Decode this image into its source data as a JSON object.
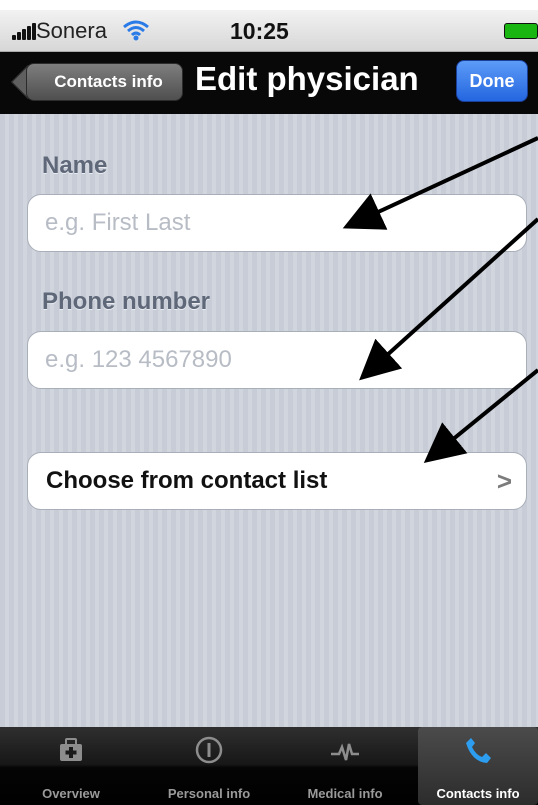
{
  "status_bar": {
    "carrier": "Sonera",
    "time": "10:25",
    "icons": {
      "signal": "signal-bars-icon",
      "wifi": "wifi-icon",
      "battery": "battery-icon"
    }
  },
  "nav_bar": {
    "back_label": "Contacts info",
    "title": "Edit physician",
    "done_label": "Done"
  },
  "form": {
    "name_label": "Name",
    "name_placeholder": "e.g. First Last",
    "phone_label": "Phone number",
    "phone_placeholder": "e.g. 123 4567890",
    "contact_button_label": "Choose from contact list",
    "disclosure": ">"
  },
  "tabs": [
    {
      "label": "Overview",
      "icon": "medical-kit-icon",
      "selected": false
    },
    {
      "label": "Personal info",
      "icon": "info-icon",
      "selected": false
    },
    {
      "label": "Medical info",
      "icon": "heartbeat-icon",
      "selected": false
    },
    {
      "label": "Contacts info",
      "icon": "phone-icon",
      "selected": true
    }
  ],
  "colors": {
    "nav_background": "#080808",
    "done_blue": "#2466e0",
    "content_background": "#c7ccd6",
    "battery_green": "#19b611"
  }
}
